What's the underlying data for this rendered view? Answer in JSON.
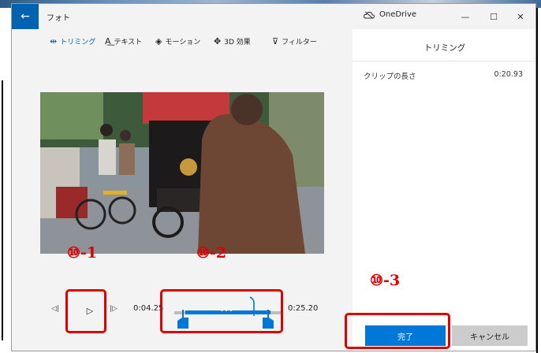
{
  "window": {
    "title": "フォト",
    "onedrive_label": "OneDrive",
    "back_icon": "←",
    "minimize_icon": "—",
    "maximize_icon": "☐",
    "close_icon": "✕"
  },
  "toolbar": {
    "items": [
      {
        "label": "トリミング",
        "icon": "trim-icon",
        "active": true
      },
      {
        "label": "テキスト",
        "icon": "text-icon",
        "active": false
      },
      {
        "label": "モーション",
        "icon": "motion-icon",
        "active": false
      },
      {
        "label": "3D 効果",
        "icon": "3d-effects-icon",
        "active": false
      },
      {
        "label": "フィルター",
        "icon": "filter-icon",
        "active": false
      }
    ]
  },
  "playback": {
    "start_time": "0:04.25",
    "end_time": "0:25.20",
    "play_icon": "▷",
    "step_back_icon": "◁|",
    "step_forward_icon": "|▷"
  },
  "panel": {
    "title": "トリミング",
    "clip_length_label": "クリップの長さ",
    "clip_length_value": "0:20.93",
    "done_label": "完了",
    "cancel_label": "キャンセル"
  },
  "annotations": {
    "label_1": "⑩-1",
    "label_2": "⑩-2",
    "label_3": "⑩-3",
    "color": "#e00000"
  },
  "colors": {
    "accent": "#0078d7",
    "back_button": "#0063b1"
  }
}
